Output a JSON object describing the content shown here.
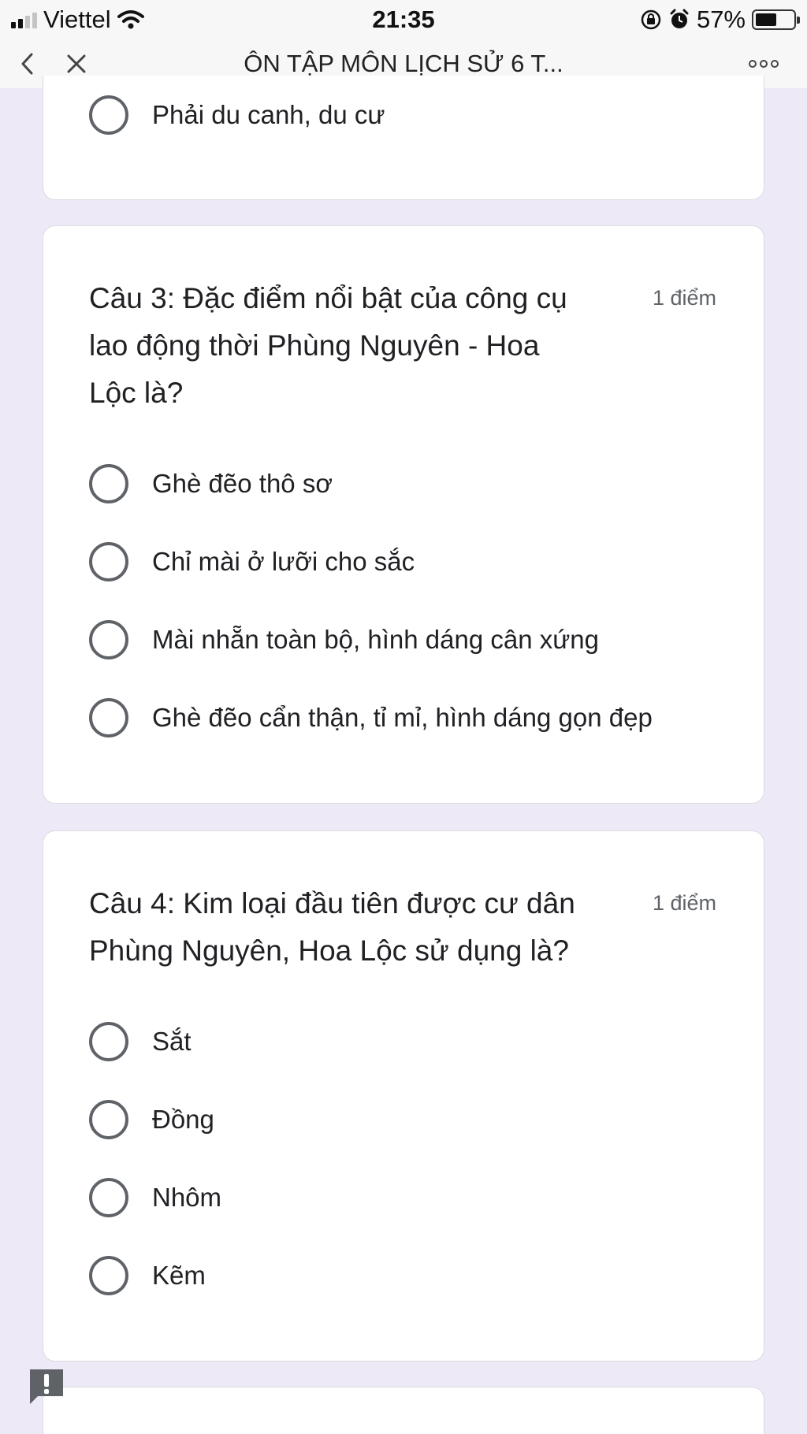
{
  "status_bar": {
    "carrier": "Viettel",
    "time": "21:35",
    "battery_percent": "57%",
    "battery_level": 0.57,
    "icons": [
      "signal-icon",
      "wifi-icon",
      "orientation-lock-icon",
      "alarm-icon",
      "battery-icon"
    ]
  },
  "nav": {
    "title": "ÔN TẬP MÔN LỊCH SỬ 6 T...",
    "icons": [
      "back-icon",
      "close-icon",
      "more-icon"
    ]
  },
  "cards": [
    {
      "options": [
        "Phải du canh, du cư"
      ]
    },
    {
      "question": "Câu 3: Đặc điểm nổi bật của công cụ lao động thời Phùng Nguyên - Hoa Lộc là?",
      "points": "1 điểm",
      "options": [
        "Ghè đẽo thô sơ",
        "Chỉ mài ở lưỡi cho sắc",
        "Mài nhẵn toàn bộ, hình dáng cân xứng",
        "Ghè đẽo cẩn thận, tỉ mỉ, hình dáng gọn đẹp"
      ]
    },
    {
      "question": "Câu 4: Kim loại đầu tiên được cư dân Phùng Nguyên, Hoa Lộc sử dụng là?",
      "points": "1 điểm",
      "options": [
        "Sắt",
        "Đồng",
        "Nhôm",
        "Kẽm"
      ]
    }
  ],
  "colors": {
    "background": "#ede9f7",
    "card": "#ffffff",
    "radio_border": "#5f6368",
    "report_button": "#5f6368"
  },
  "report_icon": "report-problem-icon"
}
